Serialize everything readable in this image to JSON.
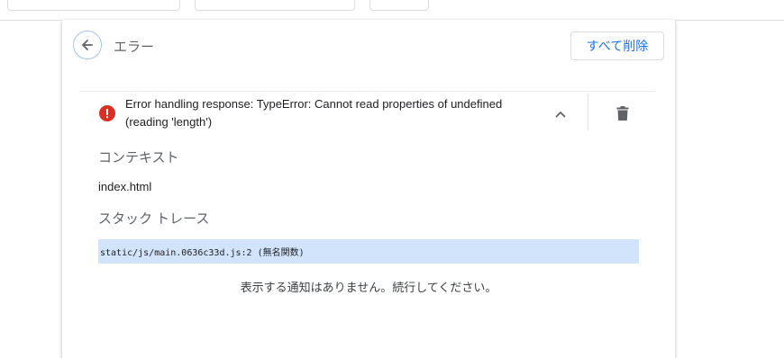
{
  "page": {
    "title": "エラー",
    "delete_all_label": "すべて削除"
  },
  "error": {
    "message": "Error handling response: TypeError: Cannot read properties of undefined (reading 'length')"
  },
  "context": {
    "heading": "コンテキスト",
    "value": "index.html"
  },
  "stack_trace": {
    "heading": "スタック トレース",
    "frames": [
      "static/js/main.0636c33d.js:2 (無名関数)"
    ]
  },
  "notice": "表示する通知はありません。続行してください。",
  "icons": {
    "back": "arrow-left-icon",
    "error": "error-circle-icon",
    "collapse": "chevron-up-icon",
    "delete": "trash-icon"
  },
  "colors": {
    "accent": "#1a73e8",
    "error": "#d93025",
    "trace_highlight": "#d2e3fc",
    "back_ring": "#a6c3ec"
  }
}
